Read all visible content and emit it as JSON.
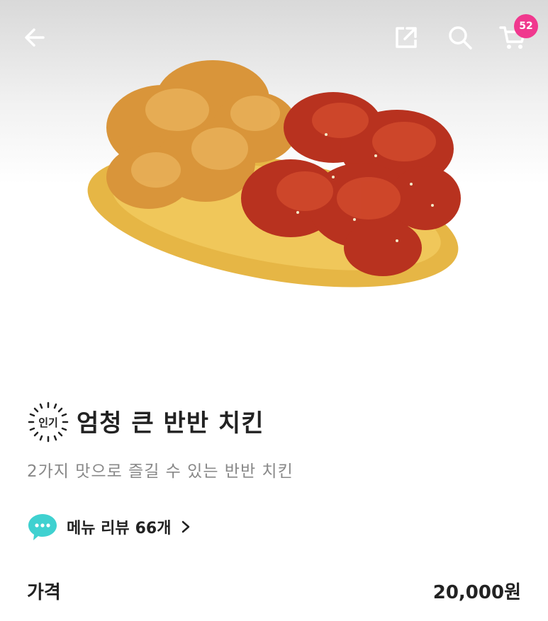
{
  "header": {
    "back_icon": "arrow-left-icon",
    "share_icon": "share-icon",
    "search_icon": "search-icon",
    "cart_icon": "cart-icon",
    "cart_count": "52",
    "badge_color": "#f0388e"
  },
  "product": {
    "image": "fried-chicken-half-and-half-plate",
    "badge_label": "인기",
    "name": "엄청 큰 반반 치킨",
    "description": "2가지 맛으로 즐길 수 있는 반반 치킨",
    "review_icon": "chat-bubble-icon",
    "review_label": "메뉴 리뷰",
    "review_count": "66개",
    "review_icon_color": "#3fd1d0"
  },
  "price": {
    "label": "가격",
    "value": "20,000원"
  }
}
